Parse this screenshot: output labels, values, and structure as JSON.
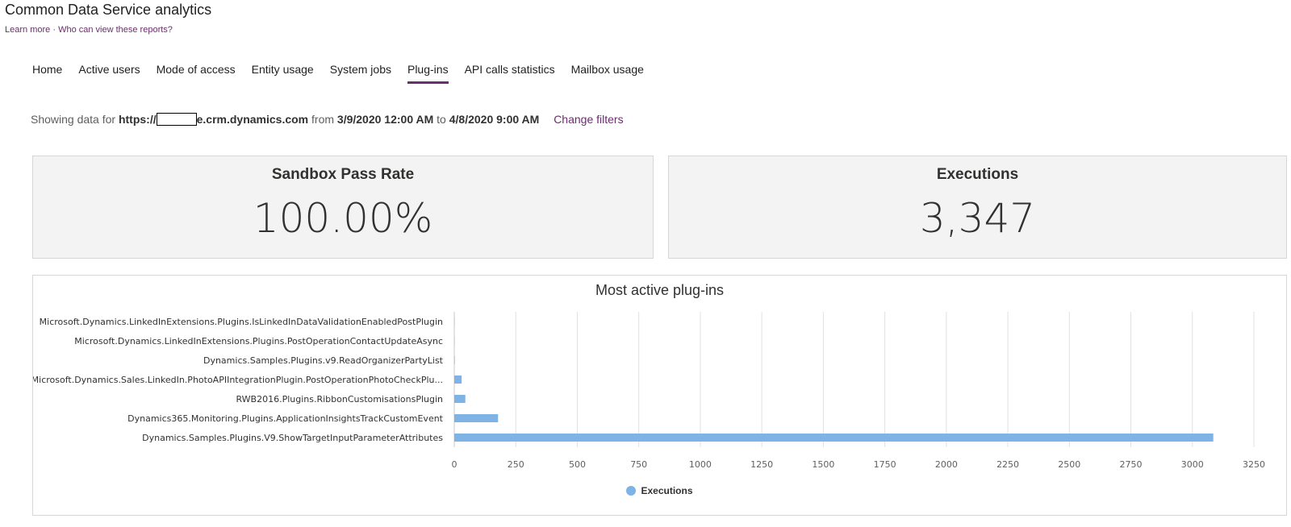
{
  "app": {
    "title": "Common Data Service analytics",
    "learn_more": "Learn more",
    "separator": "·",
    "who_can_view": "Who can view these reports?"
  },
  "tabs": [
    {
      "label": "Home",
      "active": false
    },
    {
      "label": "Active users",
      "active": false
    },
    {
      "label": "Mode of access",
      "active": false
    },
    {
      "label": "Entity usage",
      "active": false
    },
    {
      "label": "System jobs",
      "active": false
    },
    {
      "label": "Plug-ins",
      "active": true
    },
    {
      "label": "API calls statistics",
      "active": false
    },
    {
      "label": "Mailbox usage",
      "active": false
    }
  ],
  "filter": {
    "prefix": "Showing data for",
    "url_start": "https://",
    "url_end": "e.crm.dynamics.com",
    "from_word": "from",
    "from_date": "3/9/2020 12:00 AM",
    "to_word": "to",
    "to_date": "4/8/2020 9:00 AM",
    "change_filters": "Change filters"
  },
  "kpis": {
    "sandbox": {
      "title": "Sandbox Pass Rate",
      "value": "100.00%"
    },
    "executions": {
      "title": "Executions",
      "value": "3,347"
    }
  },
  "chart_data": {
    "type": "bar",
    "orientation": "horizontal",
    "title": "Most active plug-ins",
    "categories": [
      "Microsoft.Dynamics.LinkedInExtensions.Plugins.IsLinkedInDataValidationEnabledPostPlugin",
      "Microsoft.Dynamics.LinkedInExtensions.Plugins.PostOperationContactUpdateAsync",
      "Dynamics.Samples.Plugins.v9.ReadOrganizerPartyList",
      "Microsoft.Dynamics.Sales.LinkedIn.PhotoAPIIntegrationPlugin.PostOperationPhotoCheckPlu...",
      "RWB2016.Plugins.RibbonCustomisationsPlugin",
      "Dynamics365.Monitoring.Plugins.ApplicationInsightsTrackCustomEvent",
      "Dynamics.Samples.Plugins.V9.ShowTargetInputParameterAttributes"
    ],
    "series": [
      {
        "name": "Executions",
        "values": [
          1,
          1,
          2,
          30,
          45,
          178,
          3085
        ]
      }
    ],
    "xlim": [
      0,
      3250
    ],
    "xticks": [
      "0",
      "250",
      "500",
      "750",
      "1000",
      "1250",
      "1500",
      "1750",
      "2000",
      "2250",
      "2500",
      "2750",
      "3000",
      "3250"
    ],
    "grid": true,
    "legend": "bottom-center",
    "bar_color": "#7fb2e5"
  },
  "colors": {
    "accent": "#6b2d6d",
    "bar": "#7fb2e5",
    "panel": "#f3f3f3"
  }
}
